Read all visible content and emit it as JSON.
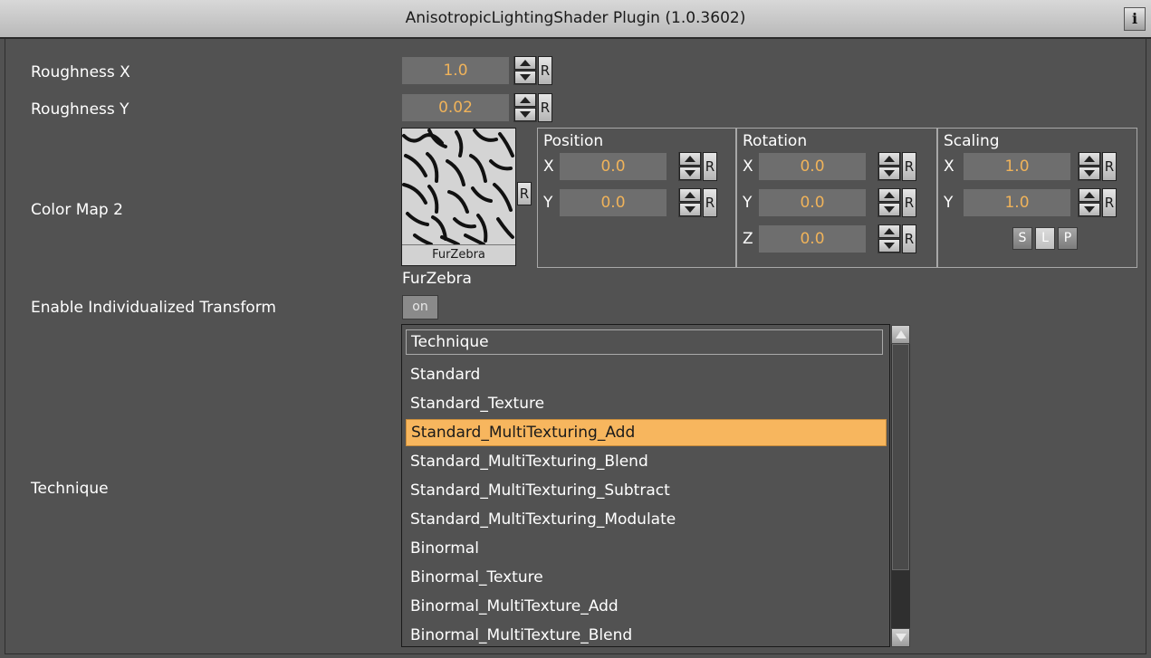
{
  "window": {
    "title": "AnisotropicLightingShader Plugin (1.0.3602)",
    "info_label": "i"
  },
  "roughness_x": {
    "label": "Roughness X",
    "value": "1.0",
    "reset": "R"
  },
  "roughness_y": {
    "label": "Roughness Y",
    "value": "0.02",
    "reset": "R"
  },
  "color_map": {
    "label": "Color Map 2",
    "thumbnail_caption": "FurZebra",
    "texture_name": "FurZebra",
    "reset": "R",
    "position": {
      "title": "Position",
      "x_label": "X",
      "x_value": "0.0",
      "y_label": "Y",
      "y_value": "0.0",
      "reset": "R"
    },
    "rotation": {
      "title": "Rotation",
      "x_label": "X",
      "x_value": "0.0",
      "y_label": "Y",
      "y_value": "0.0",
      "z_label": "Z",
      "z_value": "0.0",
      "reset": "R"
    },
    "scaling": {
      "title": "Scaling",
      "x_label": "X",
      "x_value": "1.0",
      "y_label": "Y",
      "y_value": "1.0",
      "reset": "R",
      "s_label": "S",
      "l_label": "L",
      "p_label": "P"
    }
  },
  "individual_transform": {
    "label": "Enable Individualized Transform",
    "toggle": "on"
  },
  "technique": {
    "label": "Technique",
    "header": "Technique",
    "selected": "Standard_MultiTexturing_Add",
    "items": [
      "Standard",
      "Standard_Texture",
      "Standard_MultiTexturing_Add",
      "Standard_MultiTexturing_Blend",
      "Standard_MultiTexturing_Subtract",
      "Standard_MultiTexturing_Modulate",
      "Binormal",
      "Binormal_Texture",
      "Binormal_MultiTexture_Add",
      "Binormal_MultiTexture_Blend"
    ]
  },
  "colors": {
    "background": "#525252",
    "value_text": "#f0b35a",
    "selection": "#f7b65e"
  }
}
